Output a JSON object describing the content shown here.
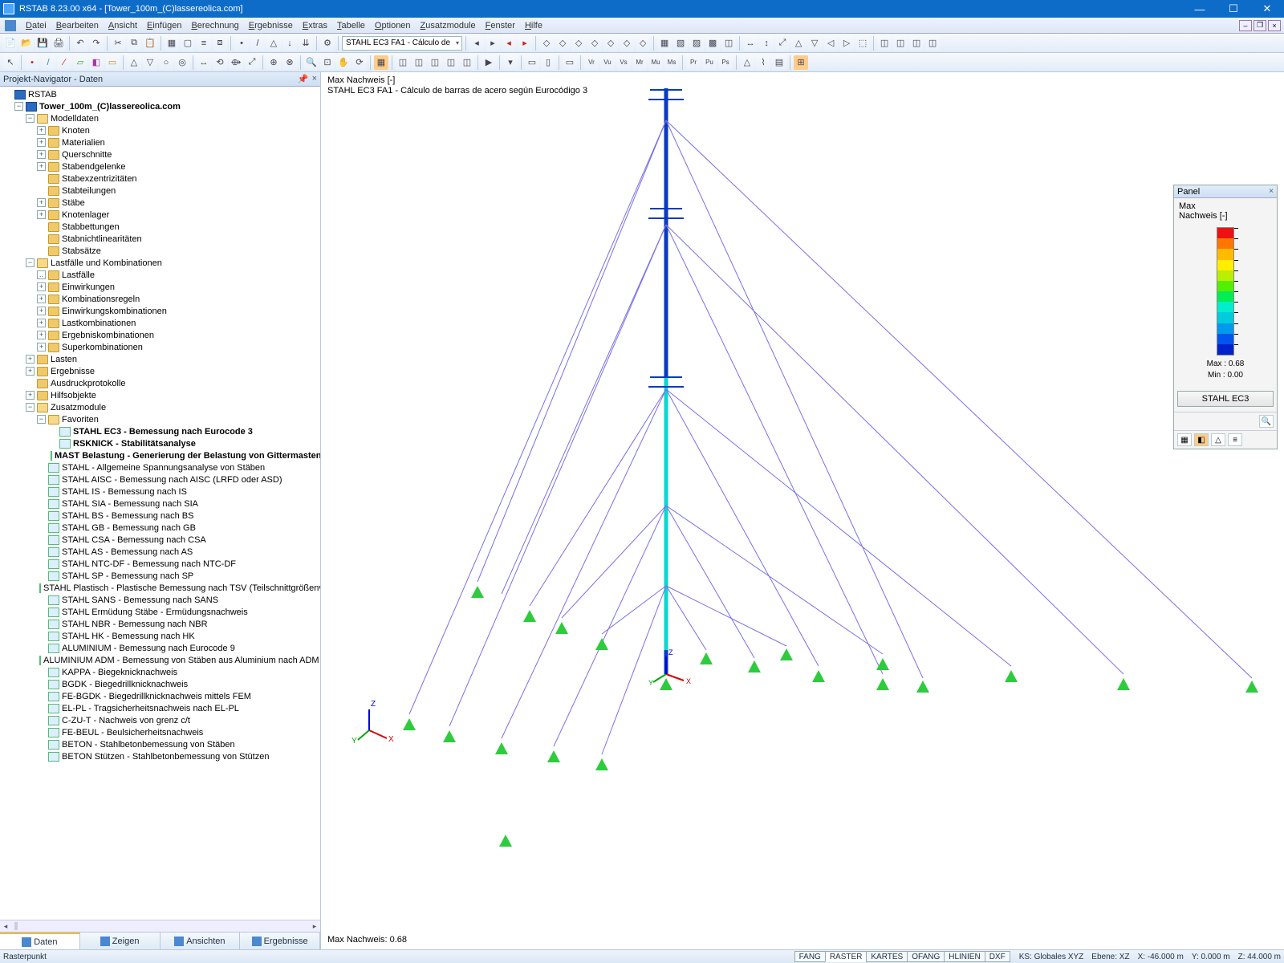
{
  "title": "RSTAB 8.23.00 x64 - [Tower_100m_(C)lassereolica.com]",
  "menu": [
    "Datei",
    "Bearbeiten",
    "Ansicht",
    "Einfügen",
    "Berechnung",
    "Ergebnisse",
    "Extras",
    "Tabelle",
    "Optionen",
    "Zusatzmodule",
    "Fenster",
    "Hilfe"
  ],
  "toolbar_dropdown": "STAHL EC3 FA1 - Cálculo de",
  "navigator": {
    "title": "Projekt-Navigator - Daten",
    "root": "RSTAB",
    "project": "Tower_100m_(C)lassereolica.com",
    "modelldaten": {
      "label": "Modelldaten",
      "items": [
        "Knoten",
        "Materialien",
        "Querschnitte",
        "Stabendgelenke",
        "Stabexzentrizitäten",
        "Stabteilungen",
        "Stäbe",
        "Knotenlager",
        "Stabbettungen",
        "Stabnichtlinearitäten",
        "Stabsätze"
      ]
    },
    "lastfaelle": {
      "label": "Lastfälle und Kombinationen",
      "items": [
        "Lastfälle",
        "Einwirkungen",
        "Kombinationsregeln",
        "Einwirkungskombinationen",
        "Lastkombinationen",
        "Ergebniskombinationen",
        "Superkombinationen"
      ]
    },
    "lasten": "Lasten",
    "ergebnisse": "Ergebnisse",
    "ausdruck": "Ausdruckprotokolle",
    "hilfs": "Hilfsobjekte",
    "zusatz": {
      "label": "Zusatzmodule",
      "fav": "Favoriten",
      "fav_items": [
        "STAHL EC3 - Bemessung nach Eurocode 3",
        "RSKNICK - Stabilitätsanalyse",
        "MAST Belastung - Generierung der Belastung von Gittermasten"
      ],
      "modules": [
        "STAHL - Allgemeine Spannungsanalyse von Stäben",
        "STAHL AISC - Bemessung nach AISC (LRFD oder ASD)",
        "STAHL IS - Bemessung nach IS",
        "STAHL SIA - Bemessung nach SIA",
        "STAHL BS - Bemessung nach BS",
        "STAHL GB - Bemessung nach GB",
        "STAHL CSA - Bemessung nach CSA",
        "STAHL AS - Bemessung nach AS",
        "STAHL NTC-DF - Bemessung nach NTC-DF",
        "STAHL SP - Bemessung nach SP",
        "STAHL Plastisch - Plastische Bemessung nach TSV (Teilschnittgrößenverfa",
        "STAHL SANS - Bemessung nach SANS",
        "STAHL Ermüdung Stäbe - Ermüdungsnachweis",
        "STAHL NBR - Bemessung nach NBR",
        "STAHL HK - Bemessung nach HK",
        "ALUMINIUM - Bemessung nach Eurocode 9",
        "ALUMINIUM ADM - Bemessung von Stäben aus Aluminium nach ADM",
        "KAPPA - Biegeknicknachweis",
        "BGDK - Biegedrillknicknachweis",
        "FE-BGDK - Biegedrillknicknachweis mittels FEM",
        "EL-PL - Tragsicherheitsnachweis nach EL-PL",
        "C-ZU-T - Nachweis von grenz c/t",
        "FE-BEUL - Beulsicherheitsnachweis",
        "BETON - Stahlbetonbemessung von Stäben",
        "BETON Stützen - Stahlbetonbemessung von Stützen"
      ]
    },
    "tabs": [
      "Daten",
      "Zeigen",
      "Ansichten",
      "Ergebnisse"
    ]
  },
  "viewport": {
    "header1": "Max Nachweis [-]",
    "header2": "STAHL EC3 FA1 - Cálculo de barras de acero según Eurocódigo 3",
    "bottom": "Max Nachweis: 0.68",
    "axes": {
      "x": "X",
      "y": "Y",
      "z": "Z"
    }
  },
  "panel": {
    "title": "Panel",
    "label1": "Max",
    "label2": "Nachweis [-]",
    "max": "Max  :  0.68",
    "min": "Min   :  0.00",
    "button": "STAHL EC3",
    "colors": [
      "#e11",
      "#f70",
      "#fb0",
      "#fe0",
      "#be0",
      "#5e0",
      "#0e5",
      "#0ec",
      "#0cd",
      "#09e",
      "#05e",
      "#02c"
    ]
  },
  "status": {
    "left": "Rasterpunkt",
    "tabs": [
      "FANG",
      "RASTER",
      "KARTES",
      "OFANG",
      "HLINIEN",
      "DXF"
    ],
    "ks": "KS: Globales XYZ",
    "ebene": "Ebene: XZ",
    "x": "X: -46.000 m",
    "y": "Y: 0.000 m",
    "z": "Z: 44.000 m"
  }
}
